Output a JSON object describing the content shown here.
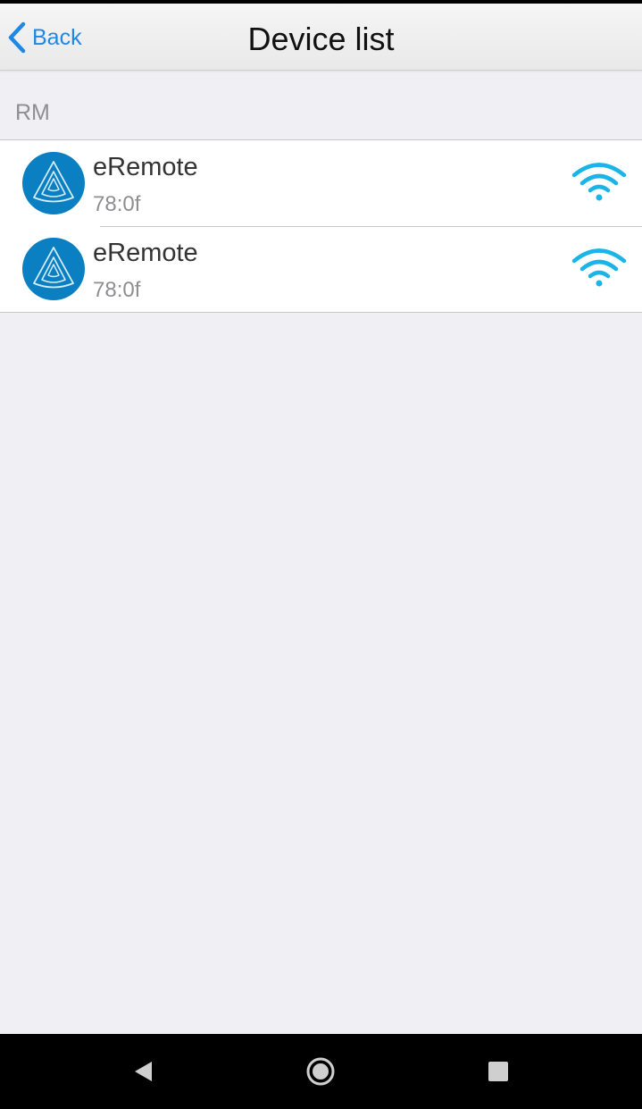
{
  "nav": {
    "back_label": "Back",
    "title": "Device list"
  },
  "section": {
    "header": "RM"
  },
  "devices": [
    {
      "name": "eRemote",
      "mac": "78:0f",
      "icon": "eremote-logo-icon",
      "signal_icon": "wifi-icon"
    },
    {
      "name": "eRemote",
      "mac": "78:0f",
      "icon": "eremote-logo-icon",
      "signal_icon": "wifi-icon"
    }
  ],
  "system_nav": {
    "back_icon": "triangle-back-icon",
    "home_icon": "circle-home-icon",
    "recents_icon": "square-recents-icon"
  },
  "colors": {
    "accent": "#1e88e5",
    "avatar": "#0a7fc2",
    "wifi": "#1ab4e8",
    "background": "#efeff4"
  }
}
